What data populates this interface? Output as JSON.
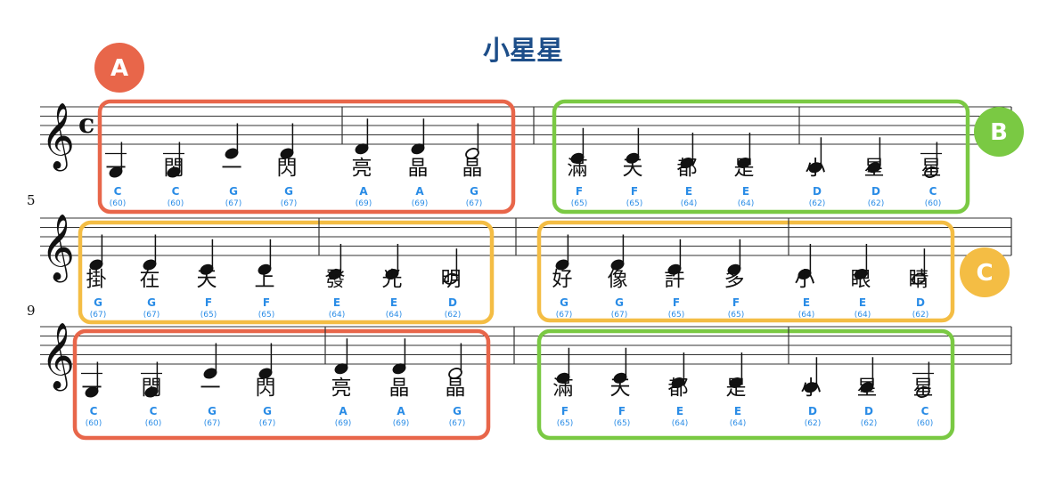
{
  "title": "小星星",
  "time_signature": "c",
  "clef": "treble-clef-icon",
  "colors": {
    "title": "#1d4e89",
    "orange": "#e8664a",
    "green": "#7ac943",
    "yellow": "#f4bd44",
    "note_label": "#2a8ce6",
    "ink": "#111111"
  },
  "badges": [
    {
      "label": "A",
      "color": "#e8664a"
    },
    {
      "label": "B",
      "color": "#7ac943"
    },
    {
      "label": "C",
      "color": "#f4bd44"
    }
  ],
  "systems": [
    {
      "number": "",
      "phrases": [
        {
          "box": "A",
          "notes": [
            {
              "lyric": "一",
              "name": "C",
              "midi": "(60)"
            },
            {
              "lyric": "閃",
              "name": "C",
              "midi": "(60)"
            },
            {
              "lyric": "一",
              "name": "G",
              "midi": "(67)"
            },
            {
              "lyric": "閃",
              "name": "G",
              "midi": "(67)"
            },
            {
              "lyric": "亮",
              "name": "A",
              "midi": "(69)"
            },
            {
              "lyric": "晶",
              "name": "A",
              "midi": "(69)"
            },
            {
              "lyric": "晶",
              "name": "G",
              "midi": "(67)"
            }
          ]
        },
        {
          "box": "B",
          "notes": [
            {
              "lyric": "滿",
              "name": "F",
              "midi": "(65)"
            },
            {
              "lyric": "天",
              "name": "F",
              "midi": "(65)"
            },
            {
              "lyric": "都",
              "name": "E",
              "midi": "(64)"
            },
            {
              "lyric": "是",
              "name": "E",
              "midi": "(64)"
            },
            {
              "lyric": "小",
              "name": "D",
              "midi": "(62)"
            },
            {
              "lyric": "星",
              "name": "D",
              "midi": "(62)"
            },
            {
              "lyric": "星",
              "name": "C",
              "midi": "(60)"
            }
          ]
        }
      ]
    },
    {
      "number": "5",
      "phrases": [
        {
          "box": "C",
          "notes": [
            {
              "lyric": "掛",
              "name": "G",
              "midi": "(67)"
            },
            {
              "lyric": "在",
              "name": "G",
              "midi": "(67)"
            },
            {
              "lyric": "天",
              "name": "F",
              "midi": "(65)"
            },
            {
              "lyric": "上",
              "name": "F",
              "midi": "(65)"
            },
            {
              "lyric": "發",
              "name": "E",
              "midi": "(64)"
            },
            {
              "lyric": "光",
              "name": "E",
              "midi": "(64)"
            },
            {
              "lyric": "明",
              "name": "D",
              "midi": "(62)"
            }
          ]
        },
        {
          "box": "C",
          "notes": [
            {
              "lyric": "好",
              "name": "G",
              "midi": "(67)"
            },
            {
              "lyric": "像",
              "name": "G",
              "midi": "(67)"
            },
            {
              "lyric": "許",
              "name": "F",
              "midi": "(65)"
            },
            {
              "lyric": "多",
              "name": "F",
              "midi": "(65)"
            },
            {
              "lyric": "小",
              "name": "E",
              "midi": "(64)"
            },
            {
              "lyric": "眼",
              "name": "E",
              "midi": "(64)"
            },
            {
              "lyric": "睛",
              "name": "D",
              "midi": "(62)"
            }
          ]
        }
      ]
    },
    {
      "number": "9",
      "phrases": [
        {
          "box": "A",
          "notes": [
            {
              "lyric": "一",
              "name": "C",
              "midi": "(60)"
            },
            {
              "lyric": "閃",
              "name": "C",
              "midi": "(60)"
            },
            {
              "lyric": "一",
              "name": "G",
              "midi": "(67)"
            },
            {
              "lyric": "閃",
              "name": "G",
              "midi": "(67)"
            },
            {
              "lyric": "亮",
              "name": "A",
              "midi": "(69)"
            },
            {
              "lyric": "晶",
              "name": "A",
              "midi": "(69)"
            },
            {
              "lyric": "晶",
              "name": "G",
              "midi": "(67)"
            }
          ]
        },
        {
          "box": "B",
          "notes": [
            {
              "lyric": "滿",
              "name": "F",
              "midi": "(65)"
            },
            {
              "lyric": "天",
              "name": "F",
              "midi": "(65)"
            },
            {
              "lyric": "都",
              "name": "E",
              "midi": "(64)"
            },
            {
              "lyric": "是",
              "name": "E",
              "midi": "(64)"
            },
            {
              "lyric": "小",
              "name": "D",
              "midi": "(62)"
            },
            {
              "lyric": "星",
              "name": "D",
              "midi": "(62)"
            },
            {
              "lyric": "星",
              "name": "C",
              "midi": "(60)"
            }
          ]
        }
      ]
    }
  ]
}
